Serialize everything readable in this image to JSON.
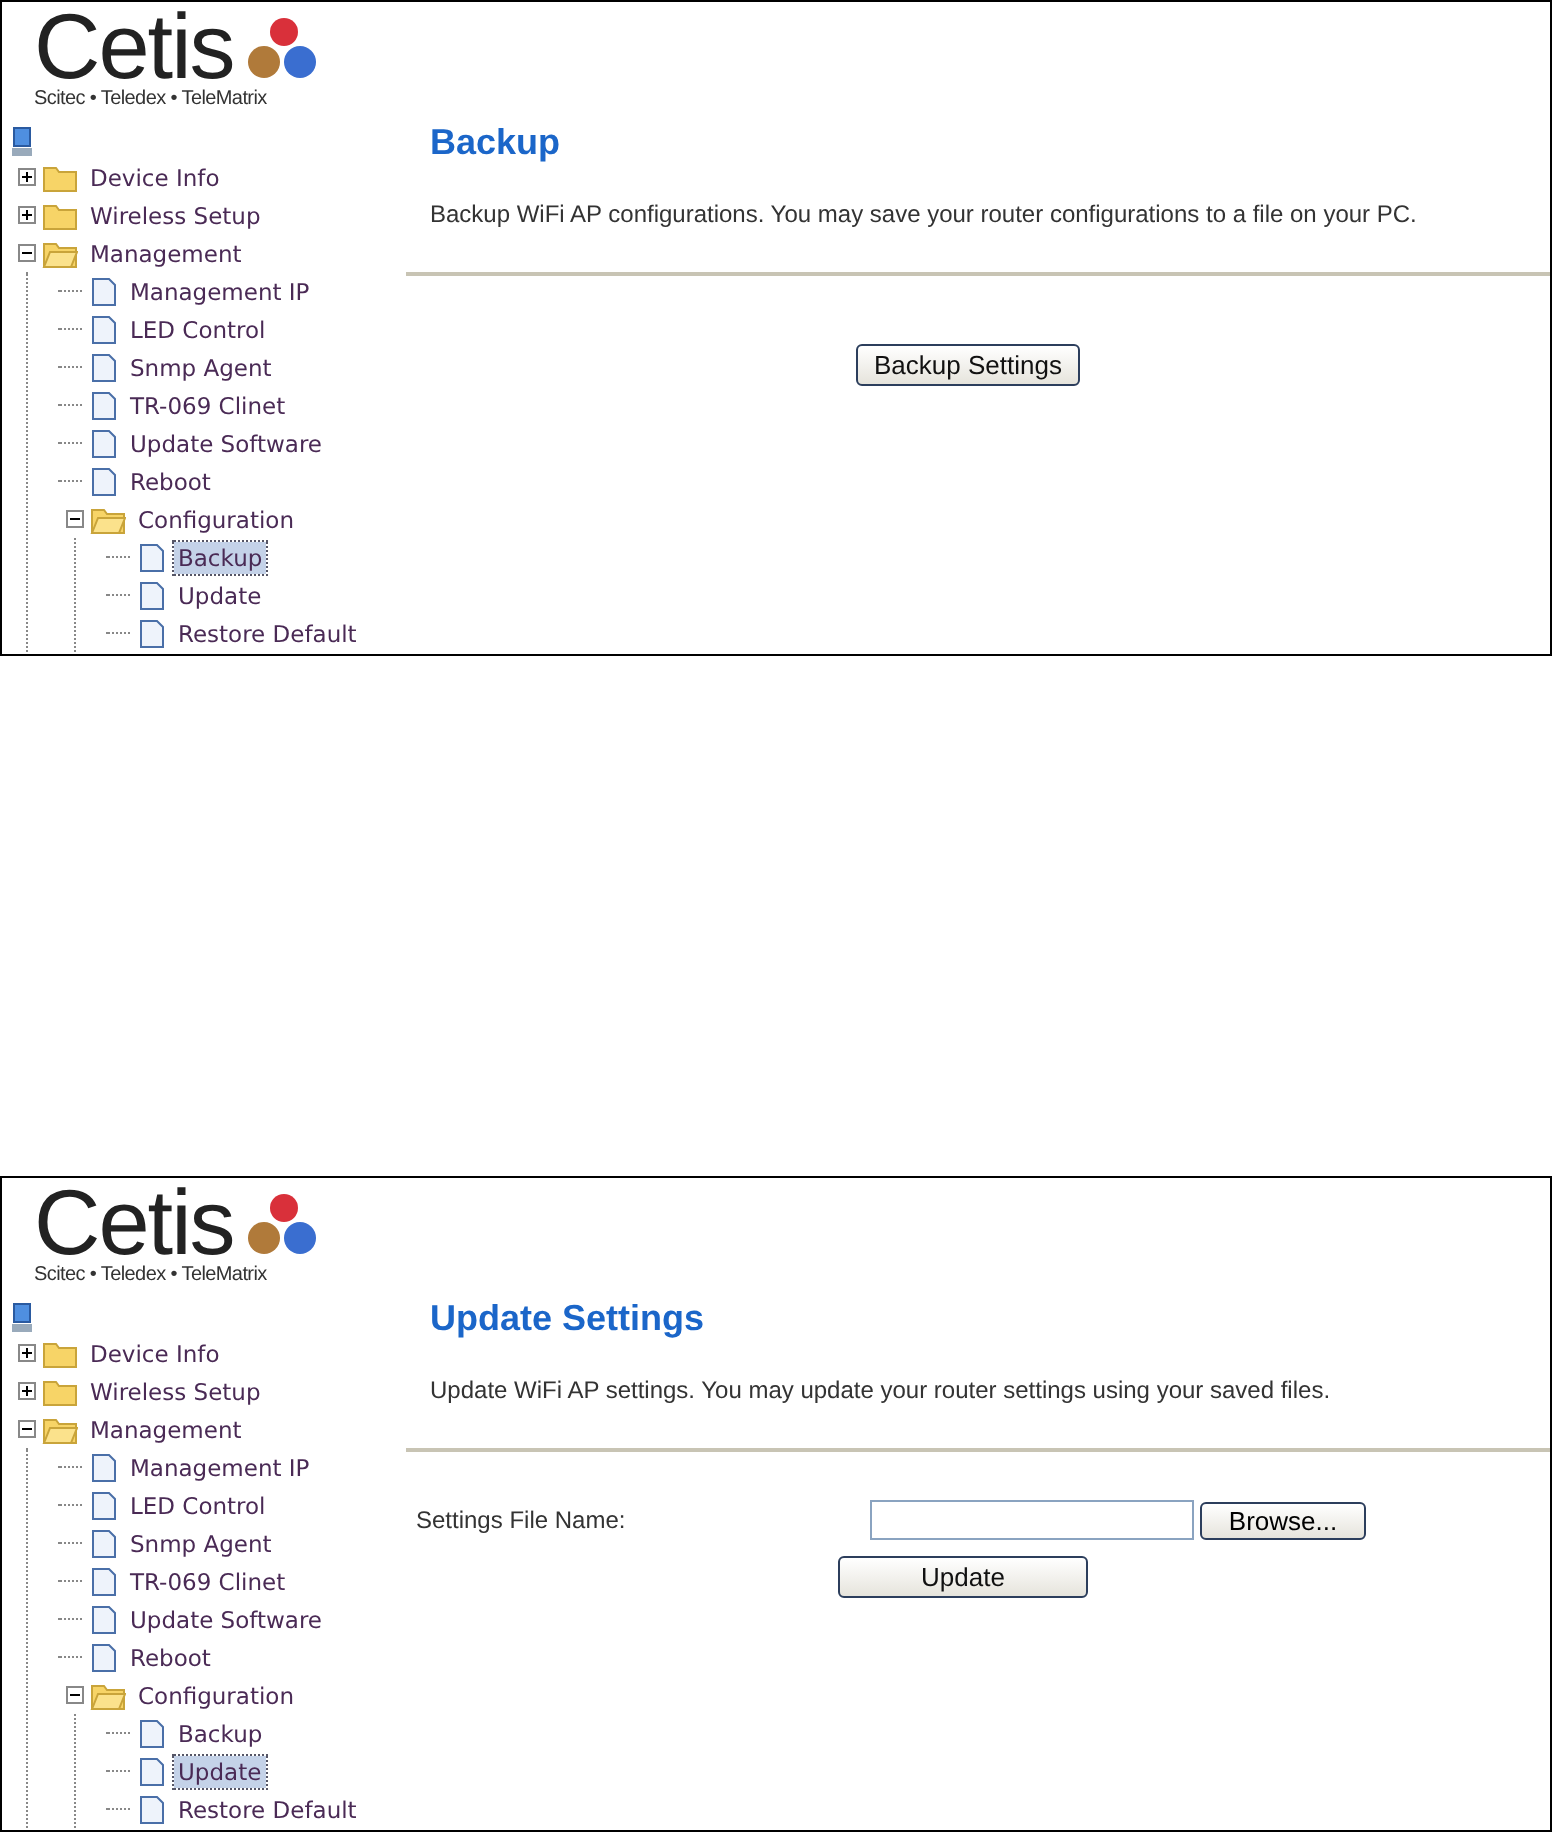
{
  "panels": [
    {
      "logo": {
        "name": "Cetis",
        "tagline": "Scitec • Teledex • TeleMatrix"
      },
      "tree": [
        {
          "label": "Device Info",
          "kind": "folder",
          "expanded": false,
          "selected": false
        },
        {
          "label": "Wireless Setup",
          "kind": "folder",
          "expanded": false,
          "selected": false
        },
        {
          "label": "Management",
          "kind": "folder",
          "expanded": true,
          "selected": false,
          "children": [
            {
              "label": "Management IP",
              "kind": "page",
              "selected": false
            },
            {
              "label": "LED Control",
              "kind": "page",
              "selected": false
            },
            {
              "label": "Snmp Agent",
              "kind": "page",
              "selected": false
            },
            {
              "label": "TR-069 Clinet",
              "kind": "page",
              "selected": false
            },
            {
              "label": "Update Software",
              "kind": "page",
              "selected": false
            },
            {
              "label": "Reboot",
              "kind": "page",
              "selected": false
            },
            {
              "label": "Configuration",
              "kind": "folder",
              "expanded": true,
              "selected": false,
              "children": [
                {
                  "label": "Backup",
                  "kind": "page",
                  "selected": true
                },
                {
                  "label": "Update",
                  "kind": "page",
                  "selected": false
                },
                {
                  "label": "Restore Default",
                  "kind": "page",
                  "selected": false
                }
              ]
            }
          ]
        }
      ],
      "content": {
        "title": "Backup",
        "description": "Backup WiFi AP configurations. You may save your router configurations to a file on your PC.",
        "action": "Backup Settings"
      }
    },
    {
      "logo": {
        "name": "Cetis",
        "tagline": "Scitec • Teledex • TeleMatrix"
      },
      "tree": [
        {
          "label": "Device Info",
          "kind": "folder",
          "expanded": false,
          "selected": false
        },
        {
          "label": "Wireless Setup",
          "kind": "folder",
          "expanded": false,
          "selected": false
        },
        {
          "label": "Management",
          "kind": "folder",
          "expanded": true,
          "selected": false,
          "children": [
            {
              "label": "Management IP",
              "kind": "page",
              "selected": false
            },
            {
              "label": "LED Control",
              "kind": "page",
              "selected": false
            },
            {
              "label": "Snmp Agent",
              "kind": "page",
              "selected": false
            },
            {
              "label": "TR-069 Clinet",
              "kind": "page",
              "selected": false
            },
            {
              "label": "Update Software",
              "kind": "page",
              "selected": false
            },
            {
              "label": "Reboot",
              "kind": "page",
              "selected": false
            },
            {
              "label": "Configuration",
              "kind": "folder",
              "expanded": true,
              "selected": false,
              "children": [
                {
                  "label": "Backup",
                  "kind": "page",
                  "selected": false
                },
                {
                  "label": "Update",
                  "kind": "page",
                  "selected": true
                },
                {
                  "label": "Restore Default",
                  "kind": "page",
                  "selected": false
                }
              ]
            }
          ]
        }
      ],
      "content": {
        "title": "Update Settings",
        "description": "Update WiFi AP settings. You may update your router settings using your saved files.",
        "field": {
          "label": "Settings File Name:",
          "button": "Browse..."
        },
        "action": "Update"
      }
    }
  ]
}
